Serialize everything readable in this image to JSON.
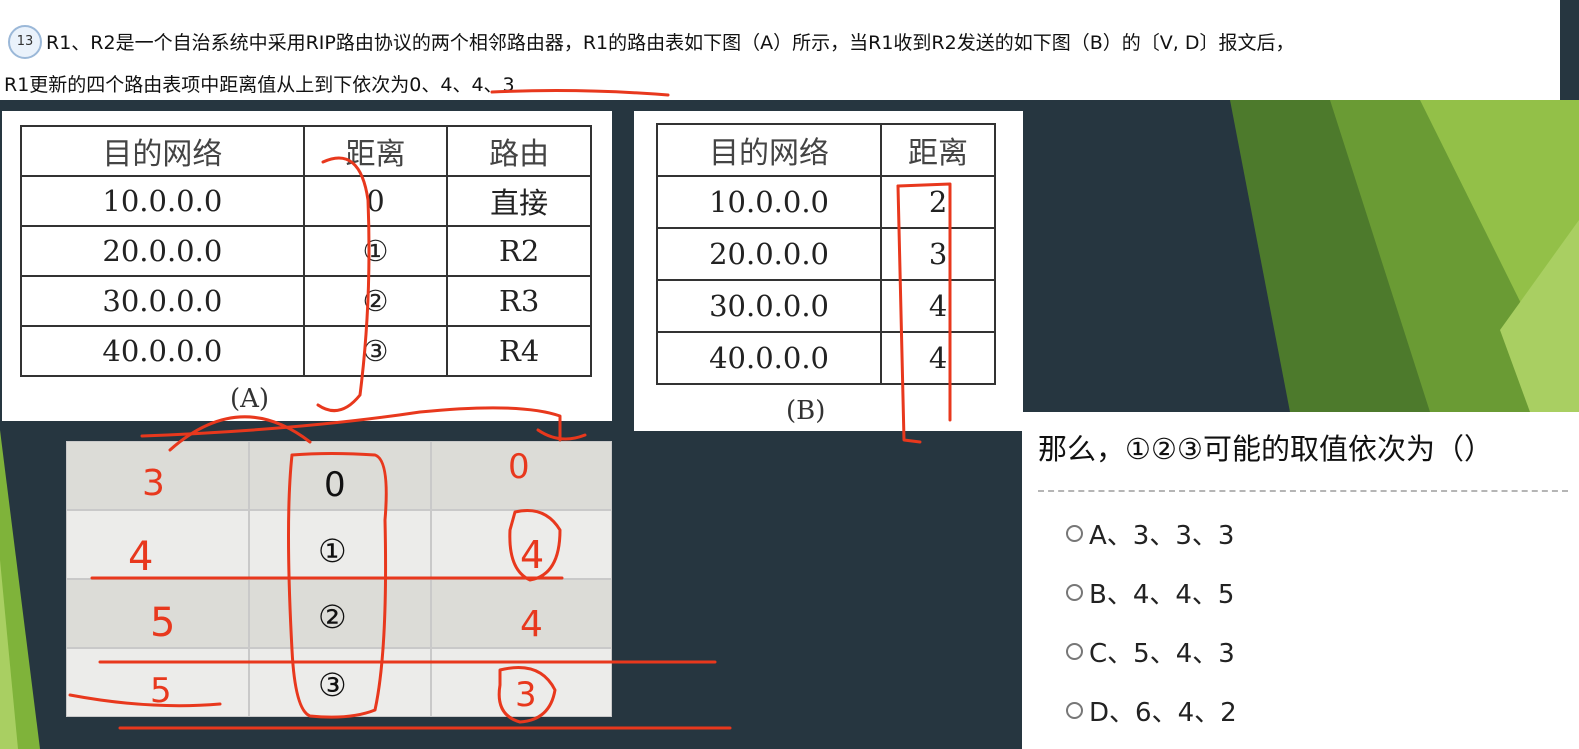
{
  "question": {
    "number": "13",
    "line1": "R1、R2是一个自治系统中采用RIP路由协议的两个相邻路由器，R1的路由表如下图（A）所示，当R1收到R2发送的如下图（B）的〔V, D〕报文后，",
    "line2": "R1更新的四个路由表项中距离值从上到下依次为0、4、4、3"
  },
  "table_a": {
    "headers": [
      "目的网络",
      "距离",
      "路由"
    ],
    "rows": [
      [
        "10.0.0.0",
        "0",
        "直接"
      ],
      [
        "20.0.0.0",
        "①",
        "R2"
      ],
      [
        "30.0.0.0",
        "②",
        "R3"
      ],
      [
        "40.0.0.0",
        "③",
        "R4"
      ]
    ],
    "caption": "(A)"
  },
  "table_b": {
    "headers": [
      "目的网络",
      "距离"
    ],
    "rows": [
      [
        "10.0.0.0",
        "2"
      ],
      [
        "20.0.0.0",
        "3"
      ],
      [
        "30.0.0.0",
        "4"
      ],
      [
        "40.0.0.0",
        "4"
      ]
    ],
    "caption": "(B)"
  },
  "work_grid": {
    "rows": [
      [
        "3",
        "0",
        "0"
      ],
      [
        "4",
        "①",
        "4"
      ],
      [
        "5",
        "②",
        "4"
      ],
      [
        "5",
        "③",
        "3"
      ]
    ]
  },
  "options": {
    "prompt": "那么，①②③可能的取值依次为（）",
    "items": [
      {
        "label": "A、3、3、3"
      },
      {
        "label": "B、4、4、5"
      },
      {
        "label": "C、5、4、3"
      },
      {
        "label": "D、6、4、2"
      }
    ]
  },
  "colors": {
    "background": "#263640",
    "annotation": "#e8381d",
    "slide_green": "#7fb33a"
  }
}
